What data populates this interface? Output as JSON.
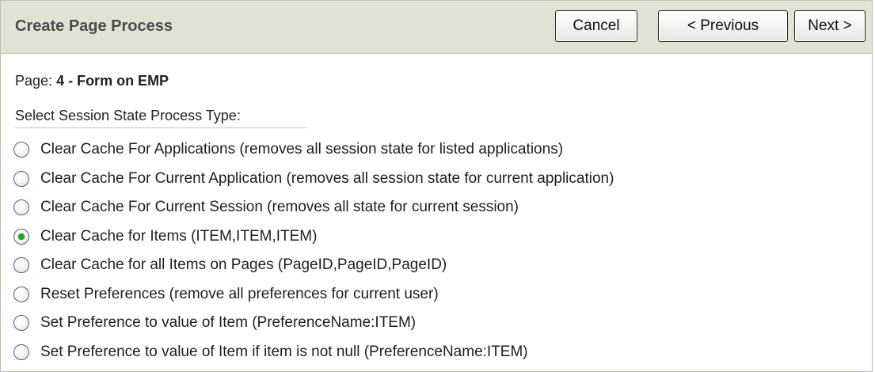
{
  "header": {
    "title": "Create Page Process",
    "buttons": {
      "cancel": "Cancel",
      "previous": "< Previous",
      "next": "Next >"
    }
  },
  "page": {
    "label": "Page:",
    "value": "4 - Form on EMP"
  },
  "process_type": {
    "label": "Select Session State Process Type:",
    "selected_index": 3,
    "options": [
      {
        "label": "Clear Cache For Applications (removes all session state for listed applications)",
        "checked": false
      },
      {
        "label": "Clear Cache For Current Application (removes all session state for current application)",
        "checked": false
      },
      {
        "label": "Clear Cache For Current Session (removes all state for current session)",
        "checked": false
      },
      {
        "label": "Clear Cache for Items (ITEM,ITEM,ITEM)",
        "checked": true
      },
      {
        "label": "Clear Cache for all Items on Pages (PageID,PageID,PageID)",
        "checked": false
      },
      {
        "label": "Reset Preferences (remove all preferences for current user)",
        "checked": false
      },
      {
        "label": "Set Preference to value of Item (PreferenceName:ITEM)",
        "checked": false
      },
      {
        "label": "Set Preference to value of Item if item is not null (PreferenceName:ITEM)",
        "checked": false
      }
    ]
  },
  "colors": {
    "header_bg": "#dfe3d3",
    "radio_selected": "#1fa52a"
  }
}
